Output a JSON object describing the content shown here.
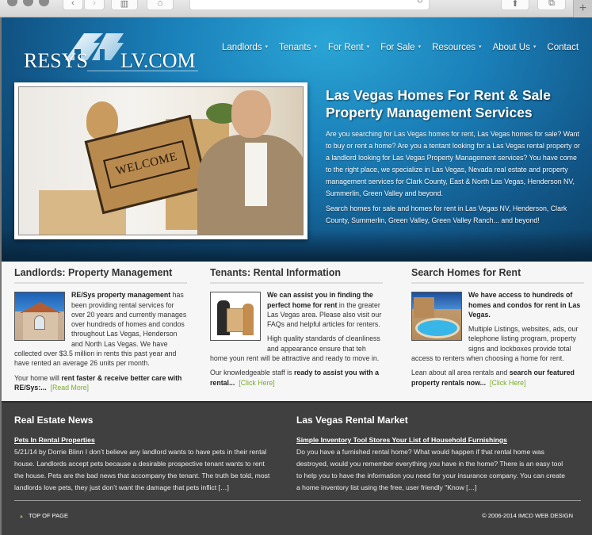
{
  "browser": {
    "back_icon": "chevron-left-icon",
    "forward_icon": "chevron-right-icon",
    "sidebar_icon": "sidebar-icon",
    "home_icon": "home-icon",
    "reload_icon": "reload-icon",
    "share_icon": "share-icon",
    "tabs_icon": "tabs-icon",
    "new_tab_label": "+"
  },
  "logo": {
    "left_text": "RESYS",
    "right_text": "LV.COM"
  },
  "nav": {
    "items": [
      {
        "label": "Landlords",
        "has_dropdown": true
      },
      {
        "label": "Tenants",
        "has_dropdown": true
      },
      {
        "label": "For Rent",
        "has_dropdown": true
      },
      {
        "label": "For Sale",
        "has_dropdown": true
      },
      {
        "label": "Resources",
        "has_dropdown": true
      },
      {
        "label": "About Us",
        "has_dropdown": true
      },
      {
        "label": "Contact",
        "has_dropdown": false
      }
    ],
    "caret": "▾"
  },
  "hero": {
    "image_text": "WELCOME",
    "title_line1": "Las Vegas Homes For Rent & Sale",
    "title_line2": "Property Management Services",
    "paragraph1": "Are you searching for Las Vegas homes for rent, Las Vegas homes for sale? Want to buy or rent a home? Are you a tentant looking for a Las Vegas rental property or a landlord looking for Las Vegas Property Management services? You have come to the right place, we specialize in Las Vegas, Nevada real estate and property management services for Clark County, East & North Las Vegas, Henderson NV, Summerlin, Green Valley and beyond.",
    "paragraph2": "Search homes for sale and homes for rent in Las Vegas NV, Henderson, Clark County, Summerlin, Green Valley, Green Valley Ranch... and beyond!"
  },
  "columns": {
    "landlords": {
      "heading": "Landlords: Property Management",
      "p1_bold": "RE/Sys property management",
      "p1_rest": " has been providing rental services for over 20 years and currently manages over hundreds of homes and condos throughout Las Vegas, Henderson and North Las Vegas. We have collected over $3.5 million in rents this past year and have rented an average 26 units per month.",
      "p2_start": "Your home will ",
      "p2_bold": "rent faster & receive better care with RE/Sys:...",
      "link": "[Read More]"
    },
    "tenants": {
      "heading": "Tenants: Rental Information",
      "p1_bold": "We can assist you in finding the perfect home for rent",
      "p1_rest": " in the greater Las Vegas area. Please also visit our FAQs and helpful articles for renters.",
      "p2": "High quality standards of cleanliness and appearance ensure that teh home youn rent will be attractive and ready to move in.",
      "p3_start": "Our knowledgeable staff is ",
      "p3_bold": "ready to assist you with a rental...",
      "link": "[Click Here]"
    },
    "search": {
      "heading": "Search Homes for Rent",
      "p1_bold": "We have access to hundreds of homes and condos for rent in Las Vegas.",
      "p2": "Multiple Listings, websites, ads, our telephone listing program, property signs and lockboxes provide total access to renters when choosing a home for rent.",
      "p3_start": "Lean about all area rentals and ",
      "p3_bold": "search our featured property rentals now...",
      "link": "[Click Here]"
    }
  },
  "news": {
    "real_estate": {
      "heading": "Real Estate News",
      "article_title": "Pets In Rental Properties",
      "excerpt": "5/21/14 by Dorrie Blinn I don’t believe any landlord wants to have pets in their rental house.  Landlords accept pets because a desirable prospective tenant wants to rent the house.  Pets are the bad news that accompany the tenant.  The truth be told, most landlords love pets, they just don’t want the damage that pets inflict […]"
    },
    "rental_market": {
      "heading": "Las Vegas Rental Market",
      "article_title": "Simple Inventory Tool Stores Your List of Household Furnishings",
      "excerpt": "Do you have a furnished rental home?  What would happen if that rental home was destroyed, would you remember everything you have in the home?  There is an easy tool to help you to have the information you need for your insurance company.  You can create a home inventory list using the free, user friendly \"Know […]"
    }
  },
  "footer": {
    "top_arrow": "▲",
    "top_label": "TOP OF PAGE",
    "copyright": "© 2006-2014 IMCD WEB DESIGN"
  },
  "colors": {
    "link_green": "#7aab2c",
    "hero_blue": "#1a7fb8",
    "footer_bg": "#404040"
  }
}
